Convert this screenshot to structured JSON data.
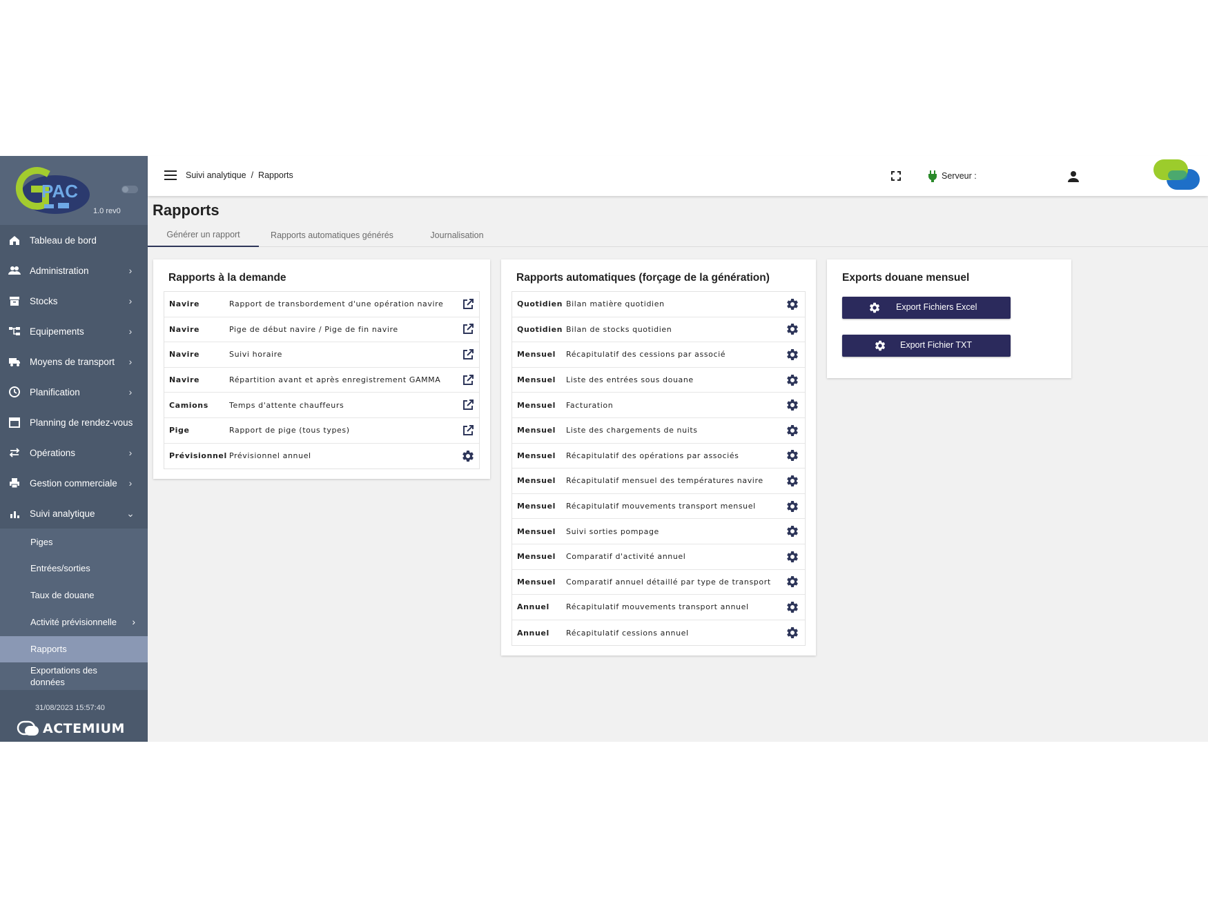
{
  "app": {
    "logo_text": "GPAC",
    "version": "1.0 rev0",
    "footer_date": "31/08/2023 15:57:40",
    "footer_brand": "ACTEMIUM"
  },
  "colors": {
    "sidebar": "#4b596c",
    "sidebar_active": "#8a98b4",
    "button": "#2b2a5c",
    "icon": "#2d3559",
    "server_status": "#2a8a2a"
  },
  "sidebar": {
    "items": [
      {
        "label": "Tableau de bord",
        "icon": "home-icon",
        "chevron": false
      },
      {
        "label": "Administration",
        "icon": "people-icon",
        "chevron": true
      },
      {
        "label": "Stocks",
        "icon": "archive-icon",
        "chevron": true
      },
      {
        "label": "Equipements",
        "icon": "tree-icon",
        "chevron": true
      },
      {
        "label": "Moyens de transport",
        "icon": "truck-icon",
        "chevron": true
      },
      {
        "label": "Planification",
        "icon": "clock-icon",
        "chevron": true
      },
      {
        "label": "Planning de rendez-vous",
        "icon": "calendar-icon",
        "chevron": false
      },
      {
        "label": "Opérations",
        "icon": "swap-icon",
        "chevron": true
      },
      {
        "label": "Gestion commerciale",
        "icon": "printer-icon",
        "chevron": true
      },
      {
        "label": "Suivi analytique",
        "icon": "bar-chart-icon",
        "chevron": true,
        "open": true
      }
    ],
    "subitems": [
      {
        "label": "Piges"
      },
      {
        "label": "Entrées/sorties"
      },
      {
        "label": "Taux de douane"
      },
      {
        "label": "Activité prévisionnelle",
        "chevron": true
      },
      {
        "label": "Rapports",
        "active": true
      },
      {
        "label": "Exportations des données"
      }
    ]
  },
  "topbar": {
    "breadcrumb_1": "Suivi analytique",
    "breadcrumb_sep": "/",
    "breadcrumb_2": "Rapports",
    "server_label": "Serveur :"
  },
  "page": {
    "title": "Rapports",
    "tabs": [
      "Générer un rapport",
      "Rapports automatiques générés",
      "Journalisation"
    ],
    "active_tab": "Générer un rapport"
  },
  "on_demand": {
    "title": "Rapports à la demande",
    "rows": [
      {
        "category": "Navire",
        "label": "Rapport de transbordement d'une opération navire",
        "action": "open-external-icon"
      },
      {
        "category": "Navire",
        "label": "Pige de début navire / Pige de fin navire",
        "action": "open-external-icon"
      },
      {
        "category": "Navire",
        "label": "Suivi horaire",
        "action": "open-external-icon"
      },
      {
        "category": "Navire",
        "label": "Répartition avant et après enregistrement GAMMA",
        "action": "open-external-icon"
      },
      {
        "category": "Camions",
        "label": "Temps d'attente chauffeurs",
        "action": "open-external-icon"
      },
      {
        "category": "Pige",
        "label": "Rapport de pige (tous types)",
        "action": "open-external-icon"
      },
      {
        "category": "Prévisionnel",
        "label": "Prévisionnel annuel",
        "action": "gear-icon"
      }
    ]
  },
  "automatic": {
    "title": "Rapports automatiques (forçage de la génération)",
    "rows": [
      {
        "category": "Quotidien",
        "label": "Bilan matière quotidien"
      },
      {
        "category": "Quotidien",
        "label": "Bilan de stocks quotidien"
      },
      {
        "category": "Mensuel",
        "label": "Récapitulatif des cessions par associé"
      },
      {
        "category": "Mensuel",
        "label": "Liste des entrées sous douane"
      },
      {
        "category": "Mensuel",
        "label": "Facturation"
      },
      {
        "category": "Mensuel",
        "label": "Liste des chargements de nuits"
      },
      {
        "category": "Mensuel",
        "label": "Récapitulatif des opérations par associés"
      },
      {
        "category": "Mensuel",
        "label": "Récapitulatif mensuel des températures navire"
      },
      {
        "category": "Mensuel",
        "label": "Récapitulatif mouvements transport mensuel"
      },
      {
        "category": "Mensuel",
        "label": "Suivi sorties pompage"
      },
      {
        "category": "Mensuel",
        "label": "Comparatif d'activité annuel"
      },
      {
        "category": "Mensuel",
        "label": "Comparatif annuel détaillé par type de transport"
      },
      {
        "category": "Annuel",
        "label": "Récapitulatif mouvements transport annuel"
      },
      {
        "category": "Annuel",
        "label": "Récapitulatif cessions annuel"
      }
    ]
  },
  "exports": {
    "title": "Exports douane mensuel",
    "buttons": [
      "Export Fichiers Excel",
      "Export Fichier TXT"
    ]
  }
}
